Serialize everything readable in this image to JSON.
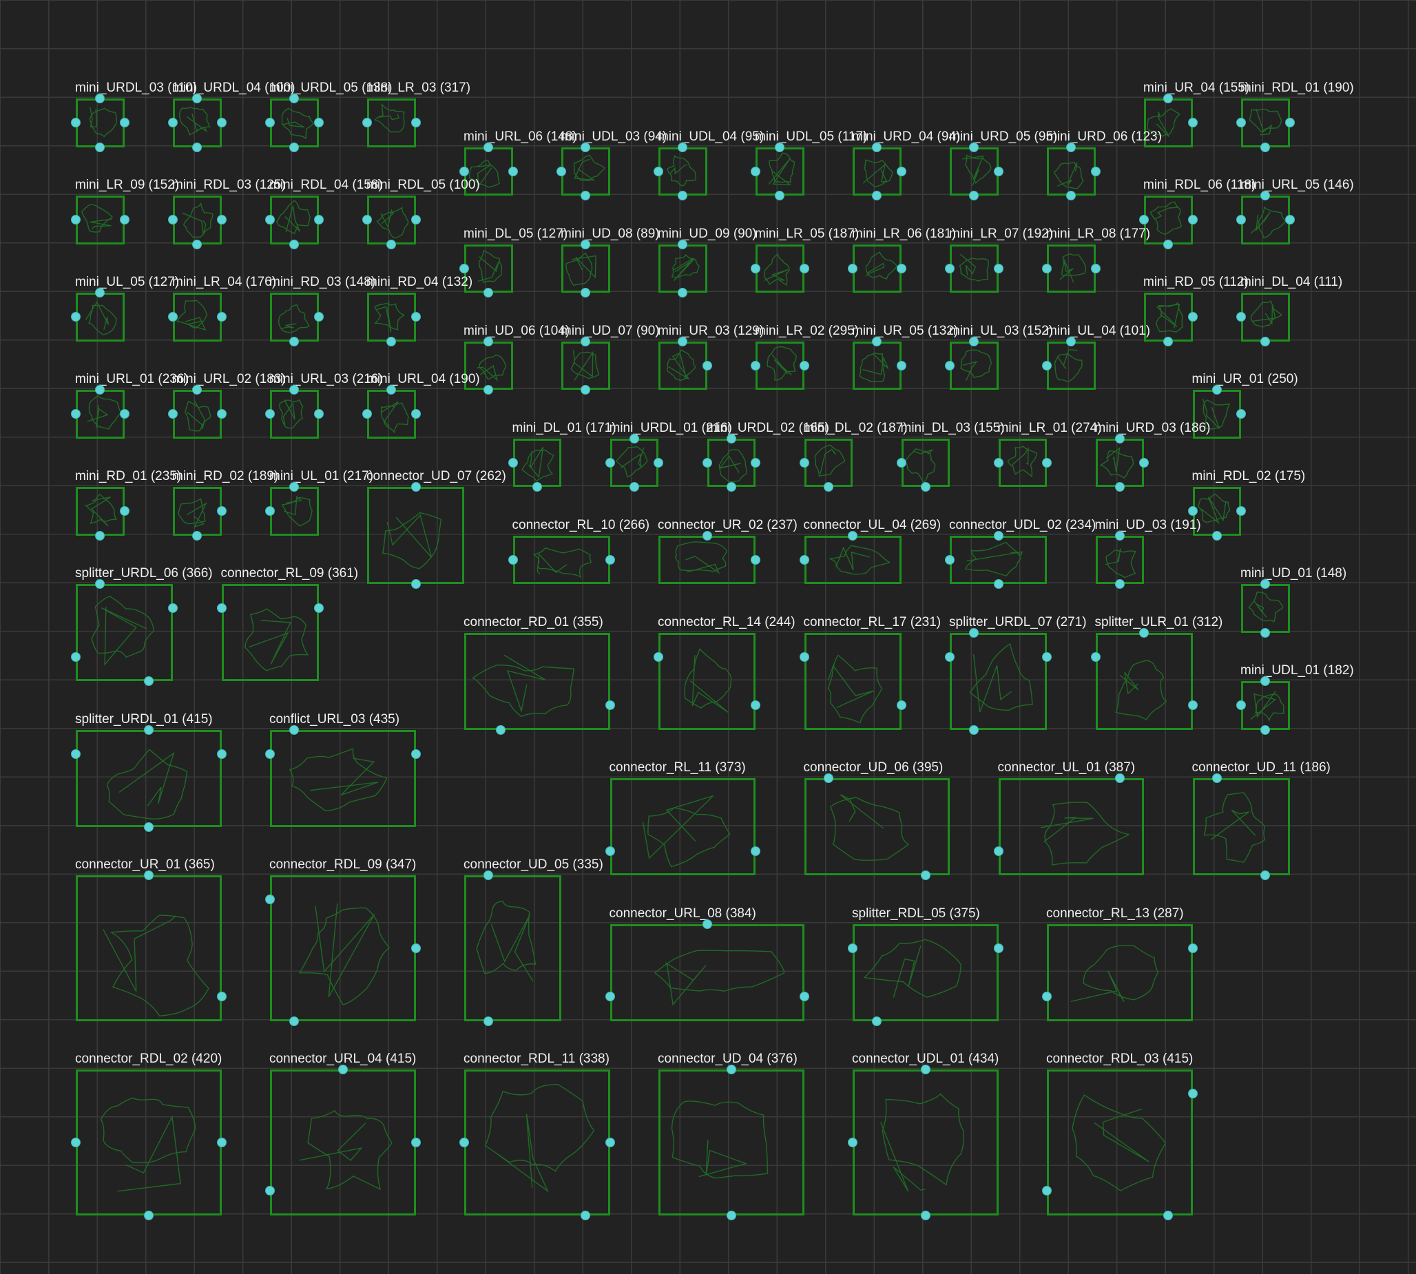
{
  "colors": {
    "background": "#222222",
    "grid": "#3a3a3a",
    "room_border": "#1e8e1e",
    "room_floor": "#1f6a25",
    "connector_dot": "#5ed4d4",
    "label": "#f0f0f0"
  },
  "rooms": [
    {
      "label": "mini_URDL_03 (110)",
      "doors": "URDL"
    },
    {
      "label": "mini_URDL_04 (100)",
      "doors": "URDL"
    },
    {
      "label": "mini_URDL_05 (138)",
      "doors": "URDL"
    },
    {
      "label": "mini_LR_03 (317)",
      "doors": "LR"
    },
    {
      "label": "mini_UR_04 (155)",
      "doors": "UR"
    },
    {
      "label": "mini_RDL_01 (190)",
      "doors": "RDL"
    },
    {
      "label": "mini_URL_06 (148)",
      "doors": "URL"
    },
    {
      "label": "mini_UDL_03 (94)",
      "doors": "UDL"
    },
    {
      "label": "mini_UDL_04 (95)",
      "doors": "UDL"
    },
    {
      "label": "mini_UDL_05 (117)",
      "doors": "UDL"
    },
    {
      "label": "mini_URD_04 (94)",
      "doors": "URD"
    },
    {
      "label": "mini_URD_05 (95)",
      "doors": "URD"
    },
    {
      "label": "mini_URD_06 (123)",
      "doors": "URD"
    },
    {
      "label": "mini_LR_09 (152)",
      "doors": "LR"
    },
    {
      "label": "mini_RDL_03 (125)",
      "doors": "RDL"
    },
    {
      "label": "mini_RDL_04 (158)",
      "doors": "RDL"
    },
    {
      "label": "mini_RDL_05 (100)",
      "doors": "RDL"
    },
    {
      "label": "mini_RDL_06 (118)",
      "doors": "RDL"
    },
    {
      "label": "mini_URL_05 (146)",
      "doors": "URL"
    },
    {
      "label": "mini_DL_05 (127)",
      "doors": "DL"
    },
    {
      "label": "mini_UD_08 (89)",
      "doors": "UD"
    },
    {
      "label": "mini_UD_09 (90)",
      "doors": "UD"
    },
    {
      "label": "mini_LR_05 (187)",
      "doors": "LR"
    },
    {
      "label": "mini_LR_06 (181)",
      "doors": "LR"
    },
    {
      "label": "mini_LR_07 (192)",
      "doors": "LR"
    },
    {
      "label": "mini_LR_08 (177)",
      "doors": "LR"
    },
    {
      "label": "mini_UL_05 (127)",
      "doors": "UL"
    },
    {
      "label": "mini_LR_04 (176)",
      "doors": "LR"
    },
    {
      "label": "mini_RD_03 (148)",
      "doors": "RD"
    },
    {
      "label": "mini_RD_04 (132)",
      "doors": "RD"
    },
    {
      "label": "mini_RD_05 (112)",
      "doors": "RD"
    },
    {
      "label": "mini_DL_04 (111)",
      "doors": "DL"
    },
    {
      "label": "mini_UD_06 (104)",
      "doors": "UD"
    },
    {
      "label": "mini_UD_07 (90)",
      "doors": "UD"
    },
    {
      "label": "mini_UR_03 (129)",
      "doors": "UR"
    },
    {
      "label": "mini_LR_02 (295)",
      "doors": "LR"
    },
    {
      "label": "mini_UR_05 (132)",
      "doors": "UR"
    },
    {
      "label": "mini_UL_03 (152)",
      "doors": "UL"
    },
    {
      "label": "mini_UL_04 (101)",
      "doors": "UL"
    },
    {
      "label": "mini_URL_01 (236)",
      "doors": "URL"
    },
    {
      "label": "mini_URL_02 (183)",
      "doors": "URL"
    },
    {
      "label": "mini_URL_03 (216)",
      "doors": "URL"
    },
    {
      "label": "mini_URL_04 (190)",
      "doors": "URL"
    },
    {
      "label": "mini_UR_01 (250)",
      "doors": "UR"
    },
    {
      "label": "mini_DL_01 (171)",
      "doors": "DL"
    },
    {
      "label": "mini_URDL_01 (216)",
      "doors": "URDL"
    },
    {
      "label": "mini_URDL_02 (165)",
      "doors": "URDL"
    },
    {
      "label": "mini_DL_02 (187)",
      "doors": "DL"
    },
    {
      "label": "mini_DL_03 (155)",
      "doors": "DL"
    },
    {
      "label": "mini_LR_01 (274)",
      "doors": "LR"
    },
    {
      "label": "mini_URD_03 (186)",
      "doors": "URD"
    },
    {
      "label": "mini_RD_01 (235)",
      "doors": "RD"
    },
    {
      "label": "mini_RD_02 (189)",
      "doors": "RD"
    },
    {
      "label": "mini_UL_01 (217)",
      "doors": "UL"
    },
    {
      "label": "connector_UD_07 (262)",
      "doors": "UD"
    },
    {
      "label": "mini_RDL_02 (175)",
      "doors": "RDL"
    },
    {
      "label": "connector_RL_10 (266)",
      "doors": "RL"
    },
    {
      "label": "connector_UR_02 (237)",
      "doors": "UR"
    },
    {
      "label": "connector_UL_04 (269)",
      "doors": "UL"
    },
    {
      "label": "connector_UDL_02 (234)",
      "doors": "UDL"
    },
    {
      "label": "mini_UD_03 (191)",
      "doors": "UD"
    },
    {
      "label": "splitter_URDL_06 (366)",
      "doors": "URDL"
    },
    {
      "label": "connector_RL_09 (361)",
      "doors": "RL"
    },
    {
      "label": "mini_UD_01 (148)",
      "doors": "UD"
    },
    {
      "label": "connector_RD_01 (355)",
      "doors": "RD"
    },
    {
      "label": "connector_RL_14 (244)",
      "doors": "RL"
    },
    {
      "label": "connector_RL_17 (231)",
      "doors": "RL"
    },
    {
      "label": "splitter_URDL_07 (271)",
      "doors": "URDL"
    },
    {
      "label": "splitter_ULR_01 (312)",
      "doors": "ULR"
    },
    {
      "label": "mini_UDL_01 (182)",
      "doors": "UDL"
    },
    {
      "label": "splitter_URDL_01 (415)",
      "doors": "URDL"
    },
    {
      "label": "conflict_URL_03 (435)",
      "doors": "URL"
    },
    {
      "label": "connector_RL_11 (373)",
      "doors": "RL"
    },
    {
      "label": "connector_UD_06 (395)",
      "doors": "UD"
    },
    {
      "label": "connector_UL_01 (387)",
      "doors": "UL"
    },
    {
      "label": "connector_UD_11 (186)",
      "doors": "UD"
    },
    {
      "label": "connector_UR_01 (365)",
      "doors": "UR"
    },
    {
      "label": "connector_RDL_09 (347)",
      "doors": "RDL"
    },
    {
      "label": "connector_UD_05 (335)",
      "doors": "UD"
    },
    {
      "label": "connector_URL_08 (384)",
      "doors": "URL"
    },
    {
      "label": "splitter_RDL_05 (375)",
      "doors": "RDL"
    },
    {
      "label": "connector_RL_13 (287)",
      "doors": "RL"
    },
    {
      "label": "connector_RDL_02 (420)",
      "doors": "RDL"
    },
    {
      "label": "connector_URL_04 (415)",
      "doors": "URL"
    },
    {
      "label": "connector_RDL_11 (338)",
      "doors": "RDL"
    },
    {
      "label": "connector_UD_04 (376)",
      "doors": "UD"
    },
    {
      "label": "connector_UDL_01 (434)",
      "doors": "UDL"
    },
    {
      "label": "connector_RDL_03 (415)",
      "doors": "RDL"
    }
  ]
}
